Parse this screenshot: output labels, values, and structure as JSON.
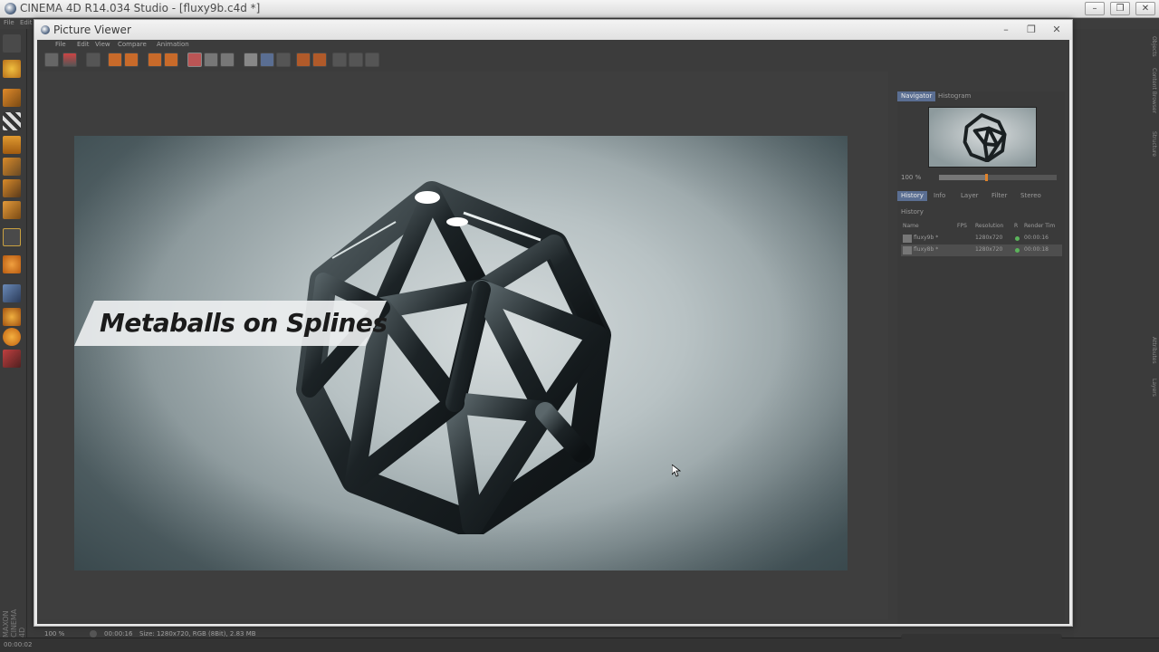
{
  "app": {
    "title": "CINEMA 4D R14.034 Studio - [fluxy9b.c4d *]",
    "menu": [
      "File",
      "Edit"
    ],
    "status_time": "00:00:02",
    "maxon_label": "MAXON CINEMA 4D",
    "side_tabs": [
      "Objects",
      "Content Browser",
      "Structure",
      "Attributes",
      "Layers"
    ]
  },
  "viewer": {
    "title": "Picture Viewer",
    "menu": [
      "File",
      "Edit",
      "View",
      "Compare",
      "Animation"
    ],
    "image_title": "Metaballs on Splines",
    "status": {
      "zoom": "100 %",
      "time": "00:00:16",
      "size": "Size: 1280x720, RGB (8Bit), 2.83 MB"
    }
  },
  "navigator": {
    "tabs": [
      "Navigator",
      "Histogram"
    ],
    "active_tab": "Navigator",
    "zoom": "100 %",
    "zoom_fraction": 0.4
  },
  "history": {
    "tabs": [
      "History",
      "Info",
      "Layer",
      "Filter",
      "Stereo"
    ],
    "active_tab": "History",
    "header": "History",
    "columns": [
      "Name",
      "FPS",
      "Resolution",
      "R",
      "Render Tim"
    ],
    "rows": [
      {
        "name": "fluxy9b *",
        "resolution": "1280x720",
        "time": "00:00:16"
      },
      {
        "name": "fluxy8b *",
        "resolution": "1280x720",
        "time": "00:00:18"
      }
    ]
  },
  "colors": {
    "accent": "#5a6e92",
    "status_ok": "#5bb35b"
  }
}
